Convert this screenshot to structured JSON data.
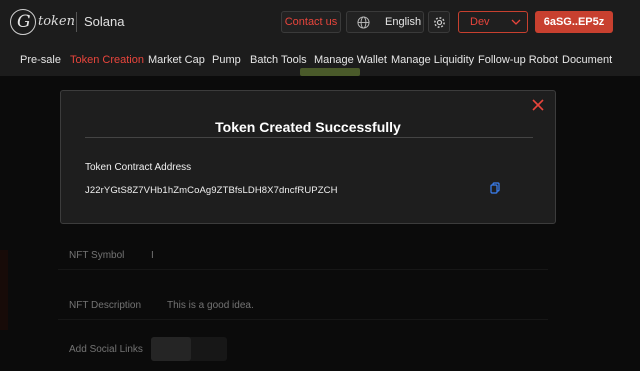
{
  "header": {
    "logo_word": "token",
    "chain": "Solana",
    "contact_label": "Contact us",
    "language": "English",
    "network": "Dev",
    "wallet": "6aSG..EP5z"
  },
  "nav": [
    "Pre-sale",
    "Token Creation",
    "Market Cap",
    "Pump",
    "Batch Tools",
    "Manage Wallet",
    "Manage Liquidity",
    "Follow-up Robot",
    "Document"
  ],
  "form": {
    "nft_symbol_label": "NFT Symbol",
    "nft_symbol_value": "I",
    "nft_description_label": "NFT Description",
    "nft_description_value": "This is a good idea.",
    "social_links_label": "Add Social Links"
  },
  "modal": {
    "title": "Token Created Successfully",
    "address_label": "Token Contract Address",
    "address_value": "J22rYGtS8Z7VHb1hZmCoAg9ZTBfsLDH8X7dncfRUPZCH"
  },
  "colors": {
    "accent": "#e8453c",
    "background": "#141414"
  }
}
